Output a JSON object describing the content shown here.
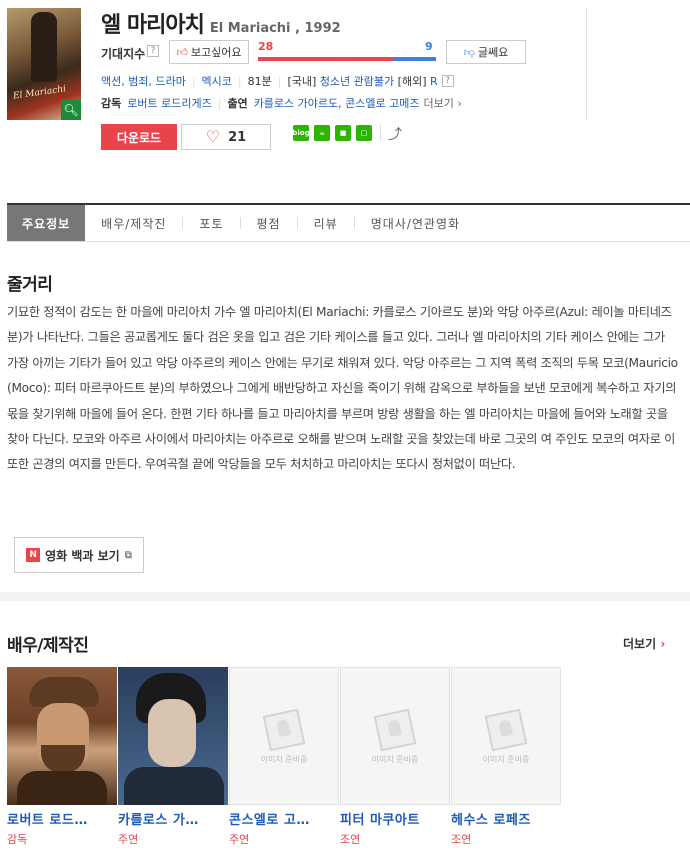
{
  "movie": {
    "title_ko": "엘 마리아치",
    "title_en": "El Mariachi , 1992",
    "poster_title": "El Mariachi",
    "expectation_label": "기대지수",
    "want_label": "보고싶어요",
    "want_count": "28",
    "no_count": "9",
    "want_ratio": 0.757,
    "no_label": "글쎄요",
    "genres": "액션, 범죄, 드라마",
    "country": "멕시코",
    "runtime": "81분",
    "domestic_prefix": "[국내]",
    "domestic_rating": "청소년 관람불가",
    "overseas_prefix": "[해외]",
    "overseas_rating": "R",
    "director_label": "감독",
    "director": "로버트 로드리게즈",
    "cast_label": "출연",
    "cast_names": "카를로스 가야르도, 콘스엘로 고메즈",
    "more_label": "더보기",
    "download_label": "다운로드",
    "like_count": "21",
    "question_mark": "?"
  },
  "share_icons": [
    "blog",
    "cafe",
    "bookmark",
    "me2"
  ],
  "tabs": [
    "주요정보",
    "배우/제작진",
    "포토",
    "평점",
    "리뷰",
    "명대사/연관영화"
  ],
  "synopsis": {
    "title": "줄거리",
    "text": "기묘한 정적이 감도는 한 마을에 마리아치 가수 엘 마리아치(El Mariachi: 카를로스 기아르도 분)와 악당 아주르(Azul: 레이놀 마티네즈 분)가 나타난다. 그들은 공교롭게도 둘다 검은 옷을 입고 검은 기타 케이스를 들고 있다. 그러나 엘 마리아치의 기타 케이스 안에는 그가 가장 아끼는 기타가 들어 있고 악당 아주르의 케이스 안에는 무기로 채워져 있다. 악당 아주르는 그 지역 폭력 조직의 두목 모코(Mauricio (Moco): 피터 마르쿠아드트 분)의 부하였으나 그에게 배반당하고 자신을 죽이기 위해 감옥으로 부하들을 보낸 모코에게 복수하고 자기의 몫을 찾기위해 마을에 들어 온다. 한편 기타 하나를 들고 마리아치를 부르며 방랑 생활을 하는 엘 마리아치는 마을에 들어와 노래할 곳을 찾아 다닌다. 모코와 아주르 사이에서 마리아치는 아주르로 오해를 받으며 노래할 곳을 찾았는데 바로 그곳의 여 주인도 모코의 여자로 이 또한 곤경의 여지를 만든다. 우여곡절 끝에 악당들을 모두 처치하고 마리아치는 또다시 정처없이 떠난다.",
    "encyclopedia_label": "영화 백과 보기",
    "encyclopedia_logo": "N"
  },
  "cast_section": {
    "title": "배우/제작진",
    "more_label": "더보기",
    "placeholder_text": "이미지 준비중",
    "people": [
      {
        "name": "로버트 로드…",
        "role": "감독",
        "has_photo": true
      },
      {
        "name": "카를로스 가…",
        "role": "주연",
        "has_photo": true
      },
      {
        "name": "콘스엘로 고…",
        "role": "주연",
        "has_photo": false
      },
      {
        "name": "피터 마쿠아트",
        "role": "조연",
        "has_photo": false
      },
      {
        "name": "헤수스 로페즈",
        "role": "조연",
        "has_photo": false
      }
    ]
  },
  "colors": {
    "accent_red": "#e8444a",
    "accent_blue": "#3d7ee0",
    "link_blue": "#1e5bb8",
    "tab_active": "#777777"
  }
}
